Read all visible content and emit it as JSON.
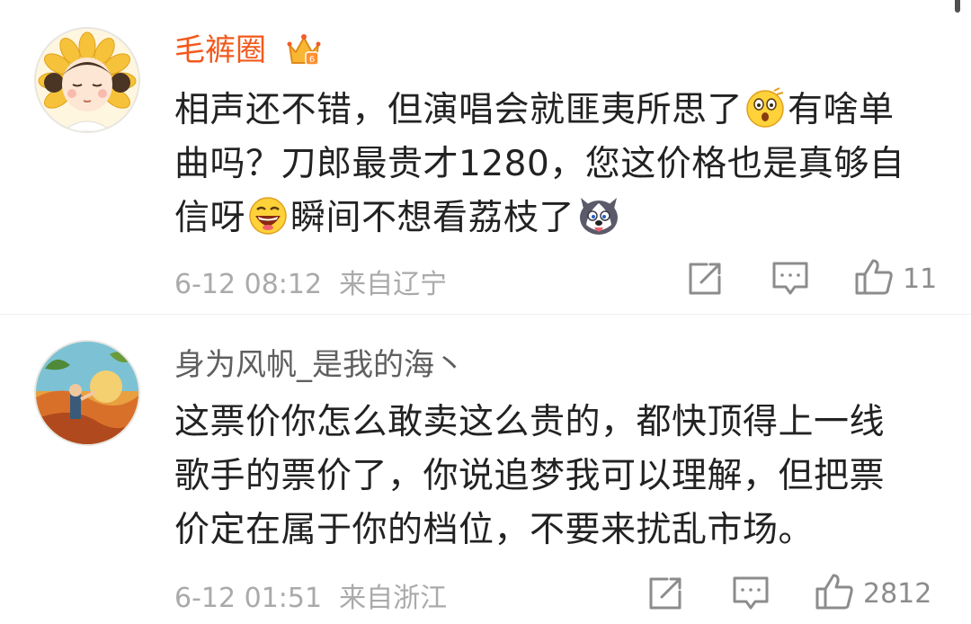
{
  "comments": [
    {
      "username": "毛裤圈",
      "is_vip": true,
      "badge_icon": "crown-badge-icon",
      "text_lines": [
        [
          "相声还不错，但演唱会就匪夷所思了",
          "有啥单"
        ],
        [
          "曲吗？刀郎最贵才1280，您这价格也是真够自"
        ],
        [
          "信呀",
          "瞬间不想看荔枝了"
        ]
      ],
      "emojis": [
        "shocked-face-emoji",
        "laughing-face-emoji",
        "husky-dog-emoji"
      ],
      "date": "6-12 08:12",
      "location": "来自辽宁",
      "like_count": "11"
    },
    {
      "username": "身为风帆_是我的海丶",
      "is_vip": false,
      "text_lines": [
        [
          "这票价你怎么敢卖这么贵的，都快顶得上一线"
        ],
        [
          "歌手的票价了，你说追梦我可以理解，但把票"
        ],
        [
          "价定在属于你的档位，不要来扰乱市场。"
        ]
      ],
      "date": "6-12 01:51",
      "location": "来自浙江",
      "like_count": "2812"
    }
  ],
  "icons": {
    "repost": "share-square-icon",
    "comment": "comment-bubble-icon",
    "like": "thumbs-up-icon"
  },
  "colors": {
    "vip_name": "#f2591c",
    "normal_name": "#5f5f5f",
    "body_text": "#222222",
    "meta_text": "#aaaaaa",
    "icon_gray": "#8c8c8c"
  }
}
